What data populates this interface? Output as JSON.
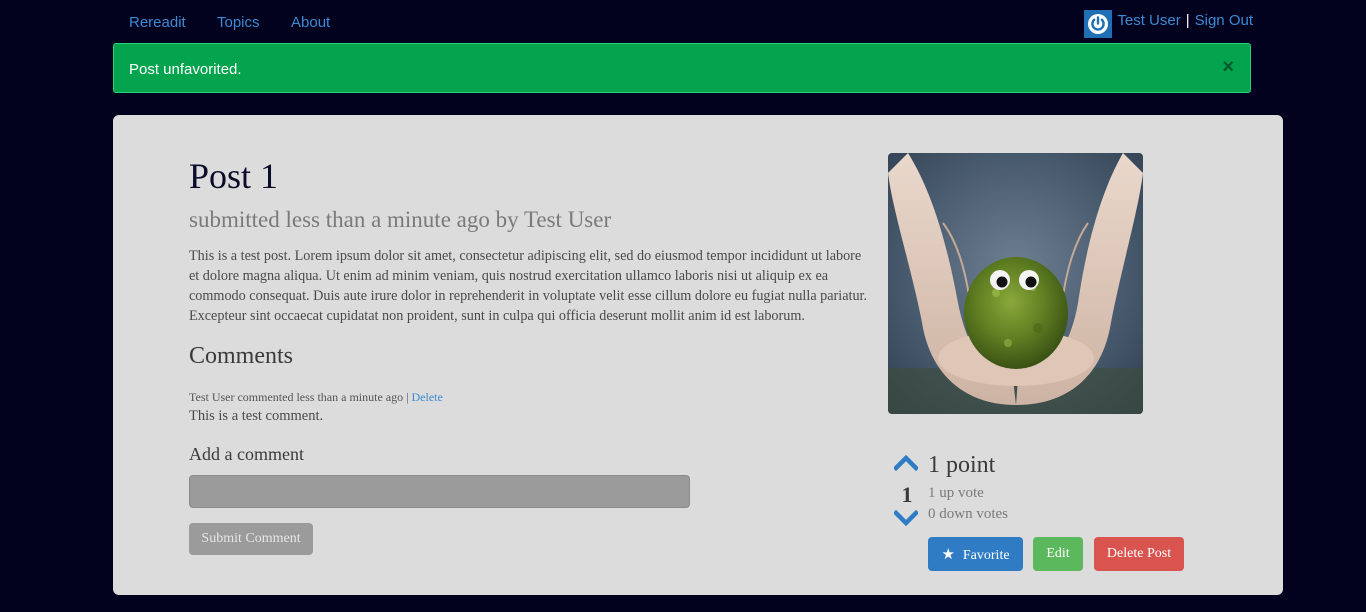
{
  "nav": {
    "brand": "Rereadit",
    "topics": "Topics",
    "about": "About"
  },
  "user": {
    "name": "Test User",
    "separator": "|",
    "sign_out": "Sign Out",
    "avatar_icon": "power-icon"
  },
  "alert": {
    "message": "Post unfavorited.",
    "close": "×"
  },
  "post": {
    "title": "Post 1",
    "subtitle": "submitted less than a minute ago by Test User",
    "body": "This is a test post. Lorem ipsum dolor sit amet, consectetur adipiscing elit, sed do eiusmod tempor incididunt ut labore et dolore magna aliqua. Ut enim ad minim veniam, quis nostrud exercitation ullamco laboris nisi ut aliquip ex ea commodo consequat. Duis aute irure dolor in reprehenderit in voluptate velit esse cillum dolore eu fugiat nulla pariatur. Excepteur sint occaecat cupidatat non proident, sunt in culpa qui officia deserunt mollit anim id est laborum."
  },
  "comments": {
    "title": "Comments",
    "items": [
      {
        "meta": "Test User commented less than a minute ago |",
        "delete_label": "Delete",
        "text": "This is a test comment."
      }
    ],
    "add_label": "Add a comment",
    "input_placeholder": "",
    "submit_label": "Submit Comment"
  },
  "votes": {
    "count": "1",
    "points": "1 point",
    "up_votes": "1 up vote",
    "down_votes": "0 down votes"
  },
  "actions": {
    "favorite": "Favorite",
    "edit": "Edit",
    "delete": "Delete Post"
  },
  "colors": {
    "background": "#03021e",
    "alert": "#04a34d",
    "link": "#3c8ad3",
    "favorite": "#2f7cc4",
    "edit": "#5cb85c",
    "delete": "#d9534f"
  }
}
